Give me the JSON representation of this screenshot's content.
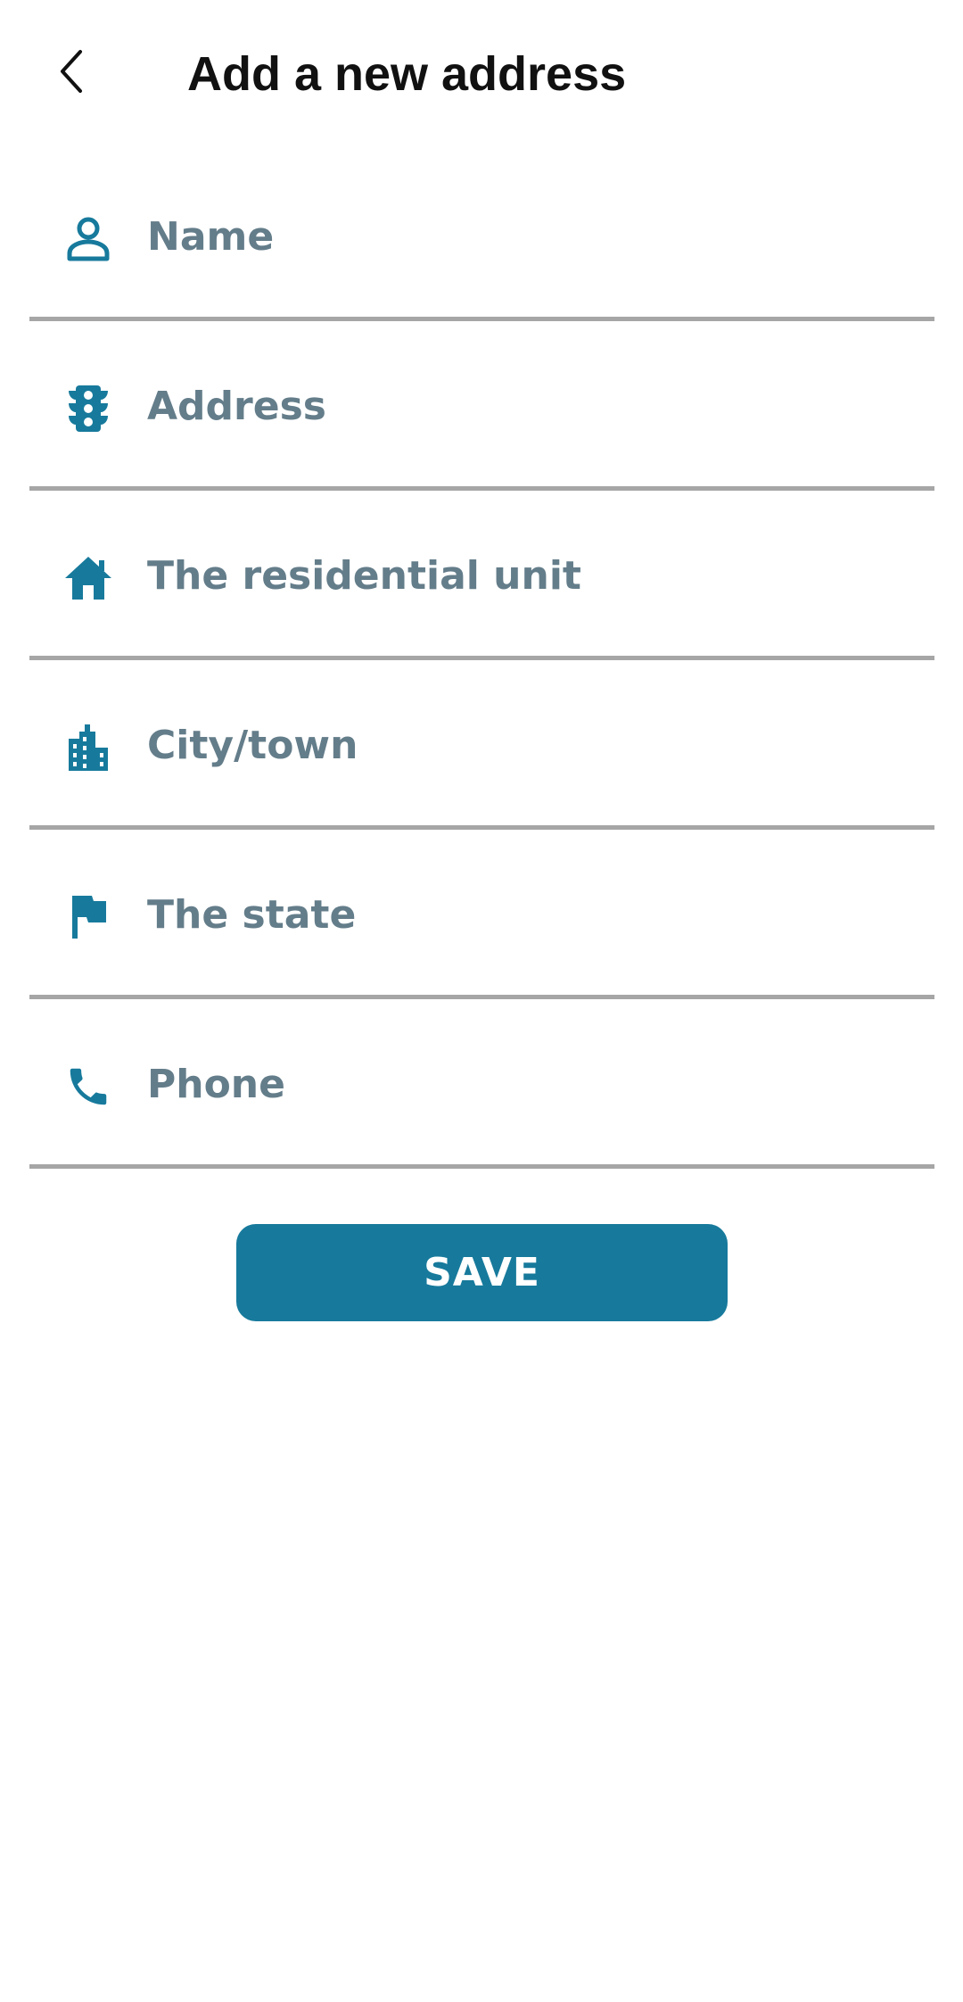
{
  "header": {
    "title": "Add a new address",
    "back_icon": "chevron-left-icon"
  },
  "form": {
    "fields": [
      {
        "icon": "person-icon",
        "placeholder": "Name",
        "value": ""
      },
      {
        "icon": "traffic-light-icon",
        "placeholder": "Address",
        "value": ""
      },
      {
        "icon": "home-icon",
        "placeholder": "The residential unit",
        "value": ""
      },
      {
        "icon": "city-icon",
        "placeholder": "City/town",
        "value": ""
      },
      {
        "icon": "flag-icon",
        "placeholder": "The state",
        "value": ""
      },
      {
        "icon": "phone-icon",
        "placeholder": "Phone",
        "value": ""
      }
    ],
    "save_label": "SAVE"
  },
  "colors": {
    "accent": "#177a9c",
    "placeholder": "#647d8a",
    "divider": "#a6a6a6",
    "title": "#111111",
    "background": "#ffffff"
  }
}
